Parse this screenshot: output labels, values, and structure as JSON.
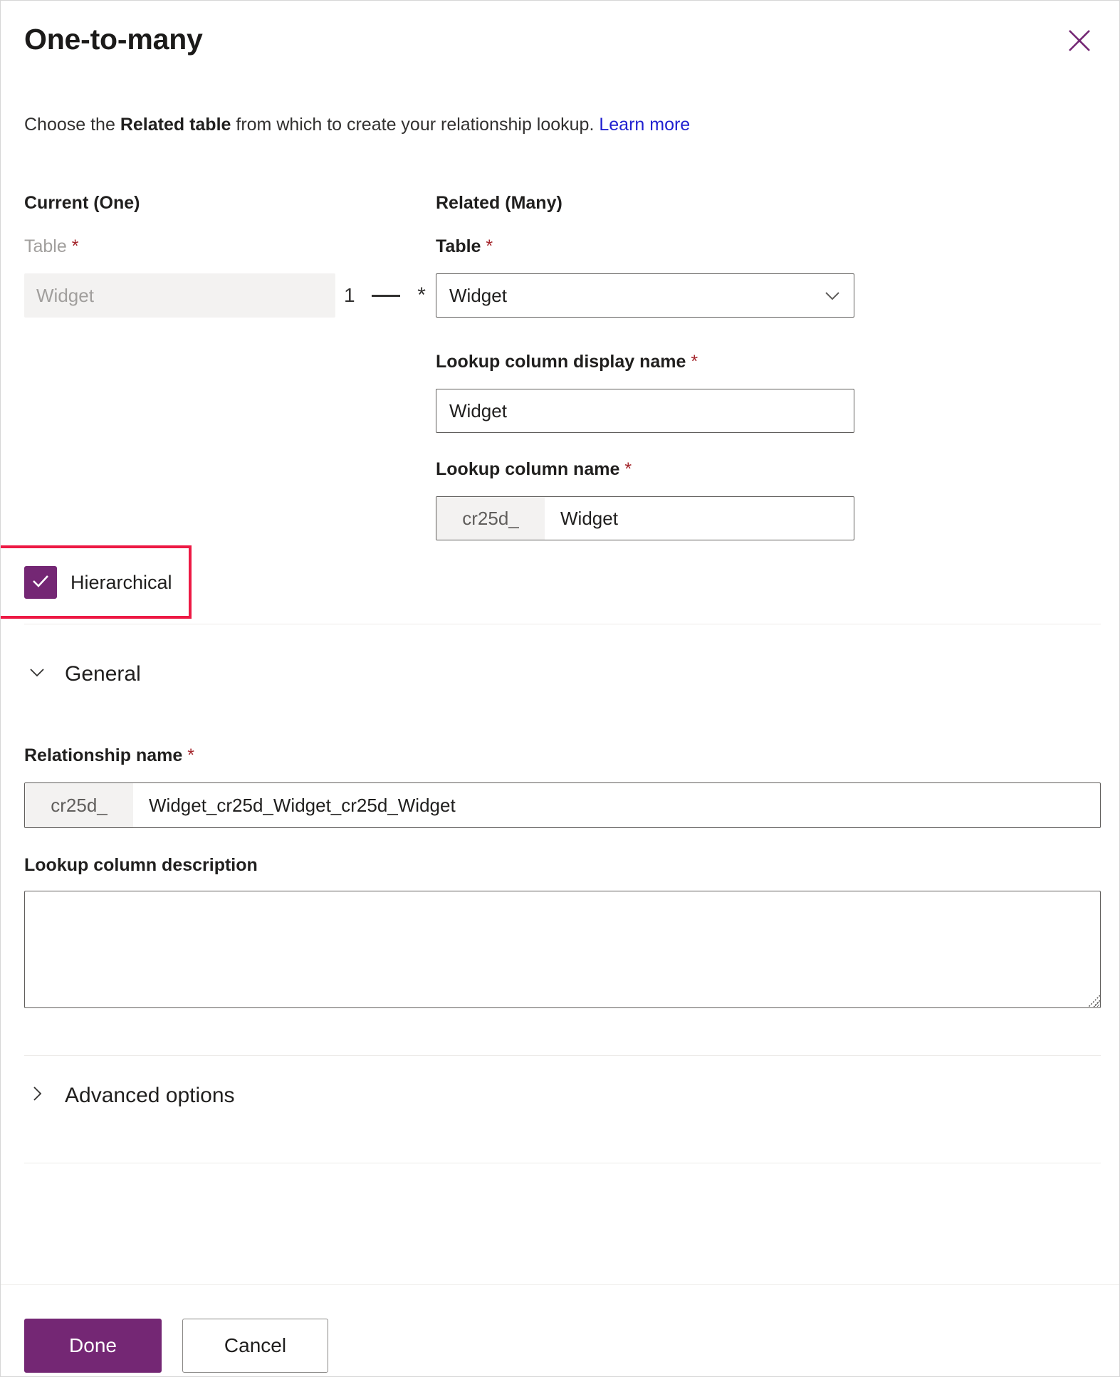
{
  "header": {
    "title": "One-to-many",
    "close_icon": "close-icon",
    "subtitle": {
      "before": "Choose the ",
      "emphasis": "Related table",
      "after": " from which to create your relationship lookup. ",
      "link": "Learn more"
    }
  },
  "colors": {
    "brand_purple": "#742774",
    "link_blue": "#2020d0",
    "required_red": "#a4262c",
    "highlight_red": "#ed1944",
    "border_gray": "#605e5c",
    "field_fill": "#f3f2f1"
  },
  "current": {
    "heading": "Current (One)",
    "table_label": "Table",
    "required_mark": "*",
    "table_value": "Widget"
  },
  "connector": {
    "one": "1",
    "many": "*"
  },
  "related": {
    "heading": "Related (Many)",
    "table_label": "Table",
    "required_mark": "*",
    "table_value": "Widget",
    "chevron_icon": "chevron-down-icon",
    "lookup_display_label": "Lookup column display name",
    "lookup_display_value": "Widget",
    "lookup_name_label": "Lookup column name",
    "lookup_name_prefix": "cr25d_",
    "lookup_name_value": "Widget"
  },
  "hierarchical": {
    "label": "Hierarchical",
    "checked": true,
    "check_icon": "check-icon"
  },
  "general": {
    "section_label": "General",
    "expanded": true,
    "chevron_icon": "chevron-down-icon",
    "relationship_name_label": "Relationship name",
    "required_mark": "*",
    "relationship_name_prefix": "cr25d_",
    "relationship_name_value": "Widget_cr25d_Widget_cr25d_Widget",
    "description_label": "Lookup column description",
    "description_value": "",
    "description_placeholder": ""
  },
  "advanced": {
    "section_label": "Advanced options",
    "expanded": false,
    "chevron_icon": "chevron-right-icon"
  },
  "footer": {
    "done_label": "Done",
    "cancel_label": "Cancel"
  }
}
